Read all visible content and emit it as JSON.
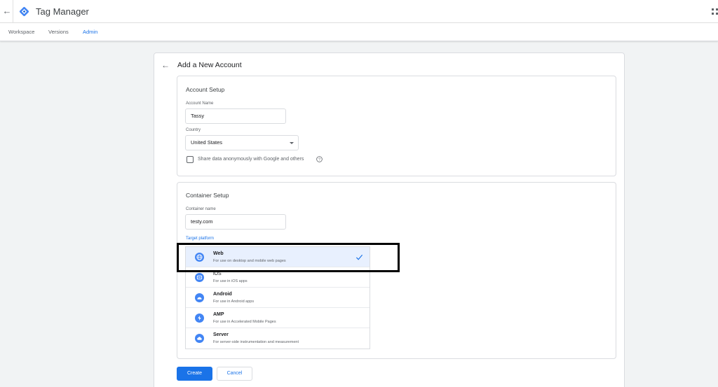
{
  "app": {
    "title": "Tag Manager"
  },
  "nav": {
    "tabs": [
      {
        "label": "Workspace"
      },
      {
        "label": "Versions"
      },
      {
        "label": "Admin"
      }
    ],
    "active_tab": "Admin"
  },
  "page": {
    "title": "Add a New Account"
  },
  "account_setup": {
    "title": "Account Setup",
    "account_name_label": "Account Name",
    "account_name_value": "Tassy",
    "country_label": "Country",
    "country_value": "United States",
    "share_data_label": "Share data anonymously with Google and others",
    "share_data_checked": false
  },
  "container_setup": {
    "title": "Container Setup",
    "container_name_label": "Container name",
    "container_name_value": "testy.com",
    "target_platform_label": "Target platform",
    "selected_platform": "Web",
    "platforms": [
      {
        "name": "Web",
        "description": "For use on desktop and mobile web pages",
        "icon": "globe-icon"
      },
      {
        "name": "iOS",
        "description": "For use in iOS apps",
        "icon": "ios-icon"
      },
      {
        "name": "Android",
        "description": "For use in Android apps",
        "icon": "android-icon"
      },
      {
        "name": "AMP",
        "description": "For use in Accelerated Mobile Pages",
        "icon": "amp-bolt-icon"
      },
      {
        "name": "Server",
        "description": "For server-side instrumentation and measurement",
        "icon": "cloud-icon"
      }
    ]
  },
  "actions": {
    "create_label": "Create",
    "cancel_label": "Cancel"
  },
  "colors": {
    "accent": "#1a73e8",
    "selected_bg": "#e8f0fe",
    "highlight_border": "#000000"
  }
}
